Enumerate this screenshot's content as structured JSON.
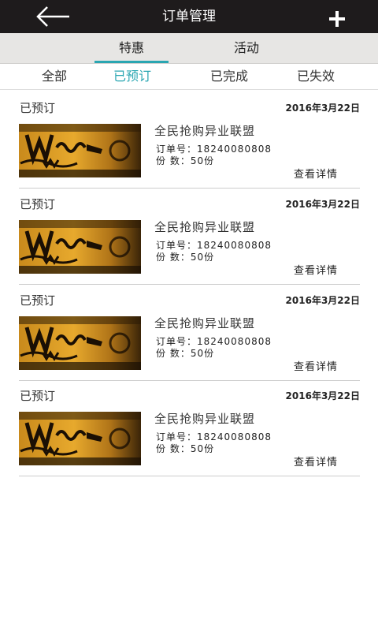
{
  "header": {
    "title": "订单管理"
  },
  "segments": {
    "items": [
      {
        "label": "特惠"
      },
      {
        "label": "活动"
      }
    ]
  },
  "filters": {
    "items": [
      {
        "label": "全部"
      },
      {
        "label": "已预订"
      },
      {
        "label": "已完成"
      },
      {
        "label": "已失效"
      }
    ]
  },
  "orders": [
    {
      "status": "已预订",
      "date": "2016年3月22日",
      "name": "全民抢购异业联盟",
      "order_no": "订单号：18240080808",
      "qty": "份  数：50份",
      "detail": "查看详情"
    },
    {
      "status": "已预订",
      "date": "2016年3月22日",
      "name": "全民抢购异业联盟",
      "order_no": "订单号：18240080808",
      "qty": "份  数：50份",
      "detail": "查看详情"
    },
    {
      "status": "已预订",
      "date": "2016年3月22日",
      "name": "全民抢购异业联盟",
      "order_no": "订单号：18240080808",
      "qty": "份  数：50份",
      "detail": "查看详情"
    },
    {
      "status": "已预订",
      "date": "2016年3月22日",
      "name": "全民抢购异业联盟",
      "order_no": "订单号：18240080808",
      "qty": "份  数：50份",
      "detail": "查看详情"
    }
  ],
  "colors": {
    "header_bg": "#1e1b1c",
    "accent": "#2aa6b2",
    "segment_bg": "#e7e6e4"
  },
  "icons": {
    "back": "back-arrow-icon",
    "add": "plus-icon"
  }
}
